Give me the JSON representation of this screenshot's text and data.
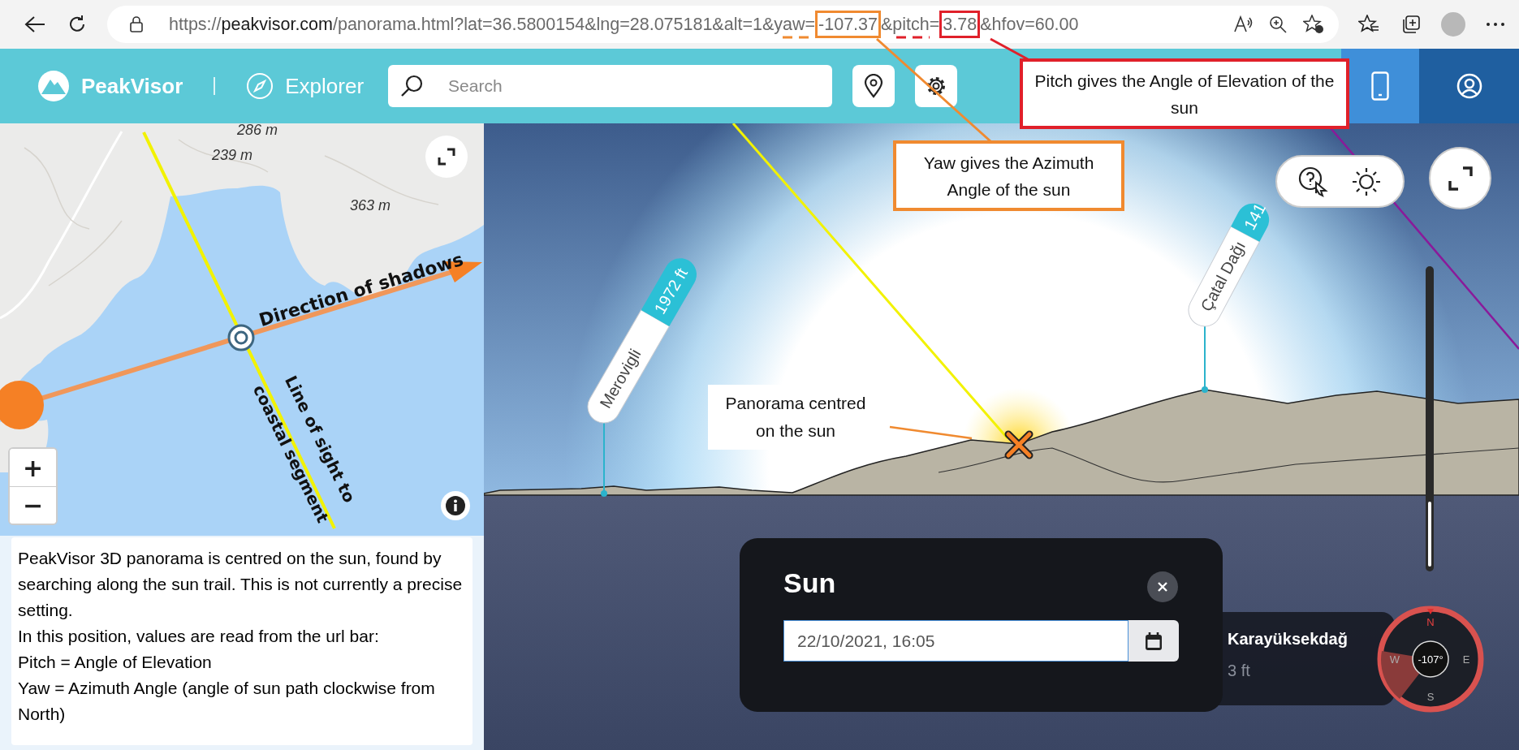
{
  "browser": {
    "url_segments": [
      {
        "text": "https://",
        "kind": "plain"
      },
      {
        "text": "peakvisor.com",
        "kind": "host"
      },
      {
        "text": "/panorama.html?lat=36.5800154&lng=28.075181&alt=1&yaw=",
        "kind": "plain"
      },
      {
        "text": "-107.37",
        "kind": "boxed",
        "color": "#f08a30"
      },
      {
        "text": "&pitch=",
        "kind": "plain"
      },
      {
        "text": "3.78",
        "kind": "boxed",
        "color": "#e0202a"
      },
      {
        "text": "&hfov=60.00",
        "kind": "plain"
      }
    ]
  },
  "header": {
    "brand": "PeakVisor",
    "mode": "Explorer",
    "search": {
      "placeholder": "Search"
    }
  },
  "map": {
    "elevation_labels": [
      "286 m",
      "239 m",
      "363 m"
    ],
    "annotations": [
      "Direction of shadows",
      "Line of sight to",
      "coastal segment"
    ],
    "zoom_in": "+",
    "zoom_out": "−"
  },
  "note": {
    "paragraphs": [
      "PeakVisor 3D panorama is centred on the sun, found by searching along the sun trail. This is not currently a precise setting.",
      "In this position, values are read from the url bar:",
      "Pitch = Angle of Elevation",
      "Yaw = Azimuth Angle (angle of sun path clockwise from North)"
    ]
  },
  "panorama": {
    "zoom": {
      "level": 0.22
    },
    "peaks": [
      {
        "name": "Merovigli",
        "elevation": "1972 ft"
      },
      {
        "name": "Çatal Dağı",
        "elevation": "141"
      }
    ],
    "sun_annotation": "Panorama centred on the sun"
  },
  "callouts": [
    {
      "text": "Pitch gives the Angle of Elevation of the sun",
      "color": "#e0202a"
    },
    {
      "text": "Yaw gives the Azimuth Angle of the sun",
      "color": "#f08a30"
    }
  ],
  "sun_dialog": {
    "title": "Sun",
    "datetime": "22/10/2021, 16:05"
  },
  "location_card": {
    "name": "Karayüksekdağ",
    "elevation": "3 ft"
  },
  "compass": {
    "north": "N",
    "east": "E",
    "south": "S",
    "west": "W",
    "heading": "-107°"
  }
}
